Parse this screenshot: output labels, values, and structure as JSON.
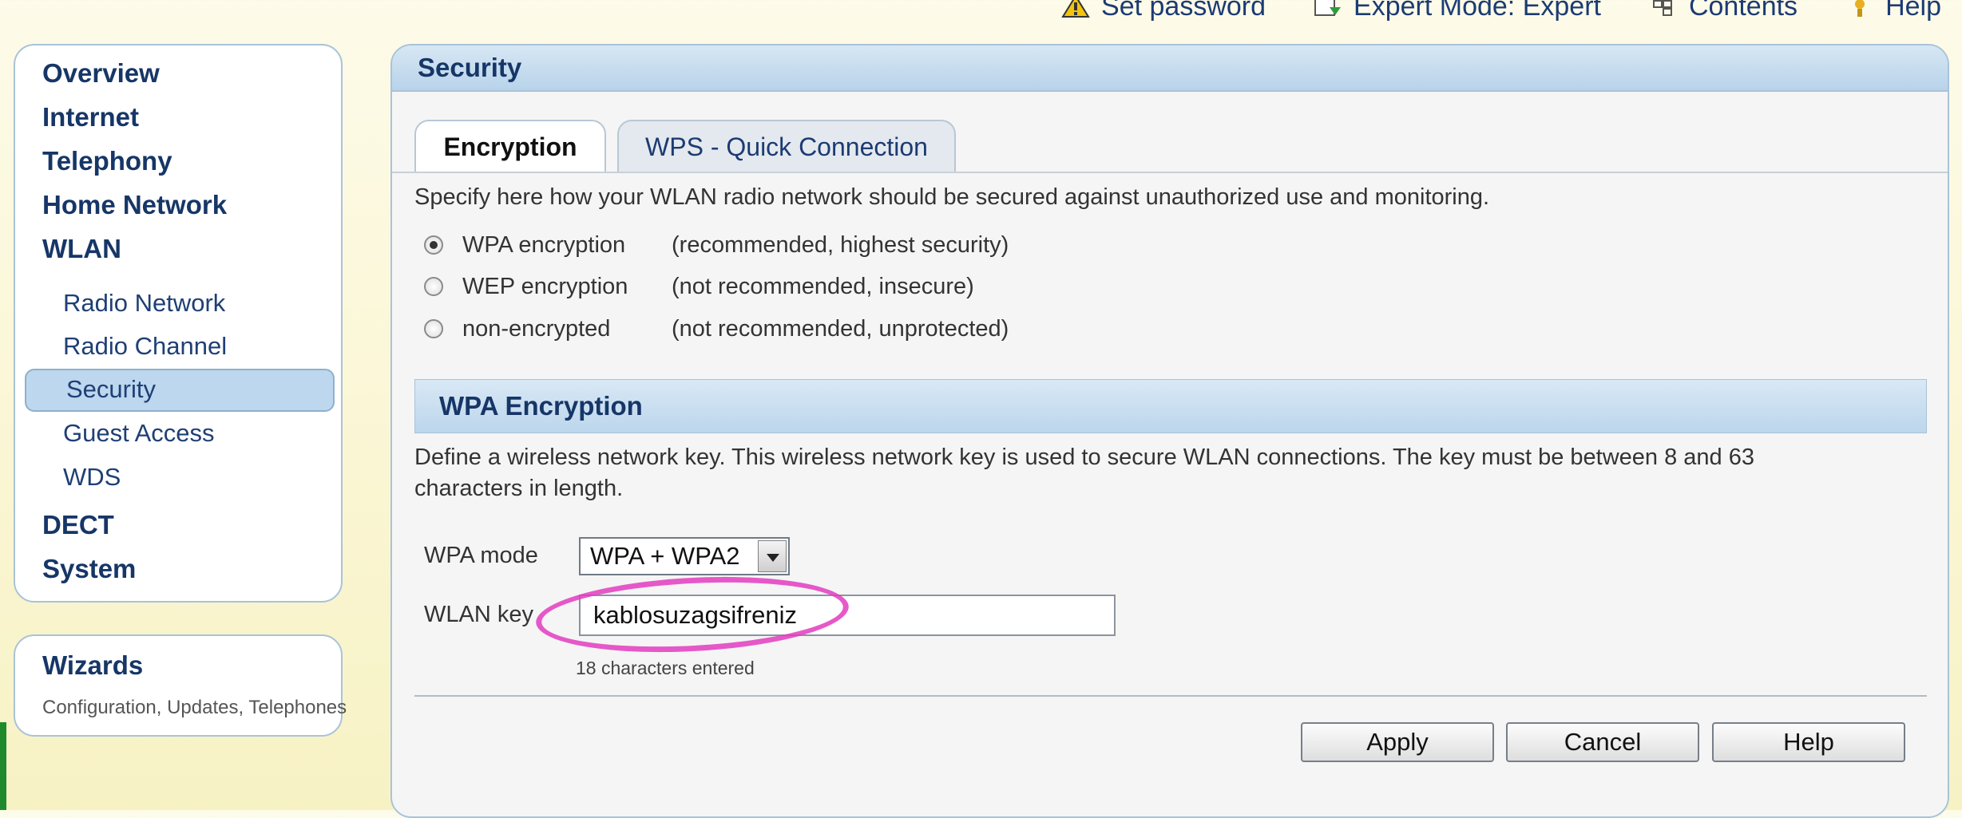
{
  "topbar": {
    "items": [
      {
        "label": "Set password",
        "icon": "warning-icon"
      },
      {
        "label": "Expert Mode: Expert",
        "icon": "expert-mode-icon"
      },
      {
        "label": "Contents",
        "icon": "contents-icon"
      },
      {
        "label": "Help",
        "icon": "help-icon"
      }
    ]
  },
  "sidebar": {
    "main": [
      "Overview",
      "Internet",
      "Telephony",
      "Home Network",
      "WLAN"
    ],
    "wlan_sub": [
      "Radio Network",
      "Radio Channel",
      "Security",
      "Guest Access",
      "WDS"
    ],
    "main_after": [
      "DECT",
      "System"
    ]
  },
  "wizards": {
    "title": "Wizards",
    "subtitle": "Configuration, Updates, Telephones"
  },
  "panel": {
    "title": "Security",
    "tabs": [
      "Encryption",
      "WPS - Quick Connection"
    ],
    "intro": "Specify here how your WLAN radio network should be secured against unauthorized use and monitoring.",
    "options": [
      {
        "label": "WPA encryption",
        "note": "(recommended, highest security)",
        "checked": true
      },
      {
        "label": "WEP encryption",
        "note": "(not recommended, insecure)",
        "checked": false
      },
      {
        "label": "non-encrypted",
        "note": "(not recommended, unprotected)",
        "checked": false
      }
    ],
    "section_title": "WPA Encryption",
    "section_desc_1": "Define a wireless network key. This wireless network key is used to secure WLAN connections. The key must be between 8 and 63",
    "section_desc_2": "characters in length.",
    "wpa_mode_label": "WPA mode",
    "wpa_mode_value": "WPA + WPA2",
    "wlan_key_label": "WLAN key",
    "wlan_key_value": "kablosuzagsifreniz",
    "chars_info": "18 characters entered",
    "buttons": {
      "apply": "Apply",
      "cancel": "Cancel",
      "help": "Help"
    }
  },
  "colors": {
    "accent": "#bcd6ec",
    "nav_text": "#163667",
    "highlight": "#e23cc0"
  }
}
